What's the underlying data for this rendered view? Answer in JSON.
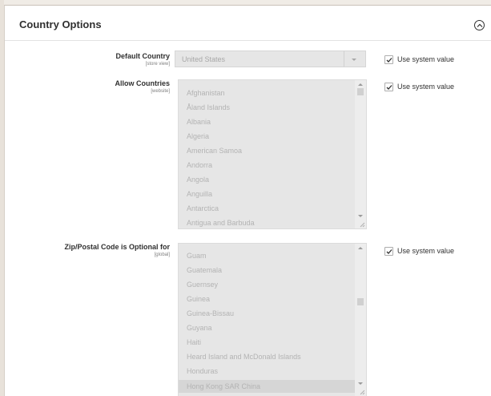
{
  "section": {
    "title": "Country Options"
  },
  "default_country": {
    "label": "Default Country",
    "scope": "[store view]",
    "value": "United States",
    "use_system_label": "Use system value"
  },
  "allow_countries": {
    "label": "Allow Countries",
    "scope": "[website]",
    "options": [
      "Afghanistan",
      "Åland Islands",
      "Albania",
      "Algeria",
      "American Samoa",
      "Andorra",
      "Angola",
      "Anguilla",
      "Antarctica",
      "Antigua and Barbuda"
    ],
    "use_system_label": "Use system value"
  },
  "zip_optional": {
    "label": "Zip/Postal Code is Optional for",
    "scope": "[global]",
    "options": [
      "Guam",
      "Guatemala",
      "Guernsey",
      "Guinea",
      "Guinea-Bissau",
      "Guyana",
      "Haiti",
      "Heard Island and McDonald Islands",
      "Honduras",
      "Hong Kong SAR China"
    ],
    "use_system_label": "Use system value"
  }
}
